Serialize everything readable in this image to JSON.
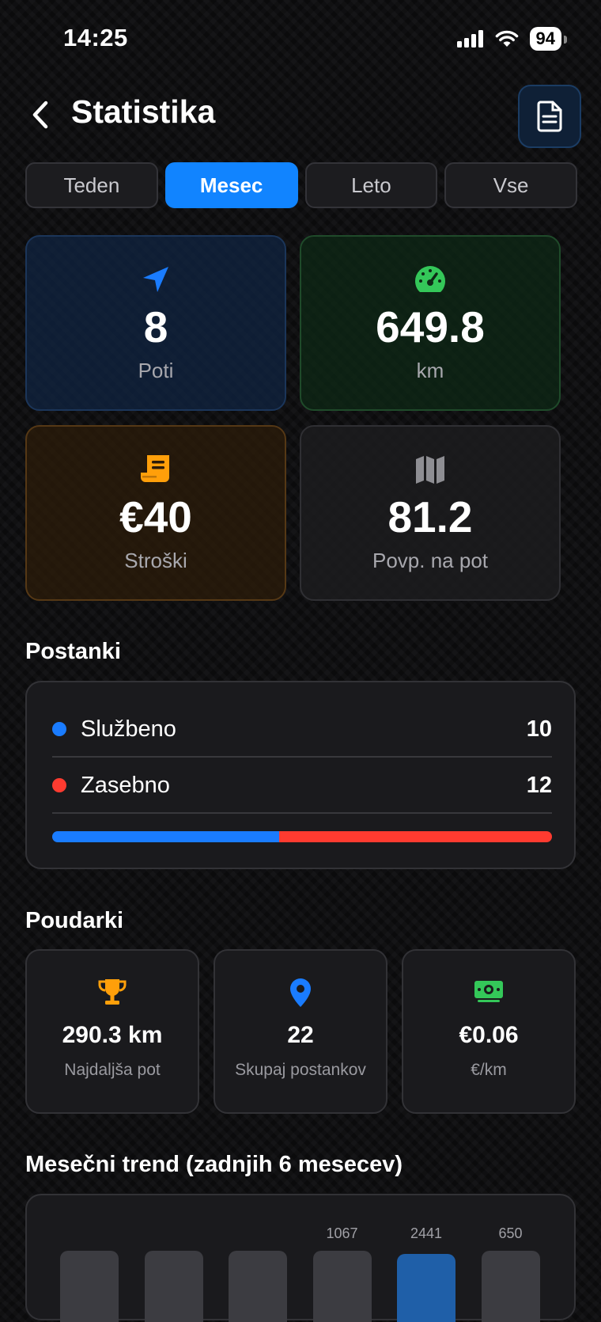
{
  "status": {
    "time": "14:25",
    "battery": "94"
  },
  "header": {
    "title": "Statistika"
  },
  "tabs": [
    {
      "label": "Teden",
      "active": false
    },
    {
      "label": "Mesec",
      "active": true
    },
    {
      "label": "Leto",
      "active": false
    },
    {
      "label": "Vse",
      "active": false
    }
  ],
  "stats": {
    "trips": {
      "value": "8",
      "label": "Poti",
      "icon": "navigation-arrow-icon",
      "color": "#1a7cff"
    },
    "distance": {
      "value": "649.8",
      "label": "km",
      "icon": "speedometer-icon",
      "color": "#34c759"
    },
    "costs": {
      "value": "€40",
      "label": "Stroški",
      "icon": "receipt-icon",
      "color": "#ff9f0a"
    },
    "average": {
      "value": "81.2",
      "label": "Povp. na pot",
      "icon": "map-icon",
      "color": "#8e8e93"
    }
  },
  "stops": {
    "title": "Postanki",
    "business": {
      "label": "Službeno",
      "count": "10",
      "color": "#1a7cff"
    },
    "private": {
      "label": "Zasebno",
      "count": "12",
      "color": "#ff3b30"
    },
    "business_share": 0.4545
  },
  "highlights": {
    "title": "Poudarki",
    "items": [
      {
        "value": "290.3 km",
        "label": "Najdaljša pot",
        "icon": "trophy-icon",
        "color": "#ff9f0a"
      },
      {
        "value": "22",
        "label": "Skupaj postankov",
        "icon": "location-pin-icon",
        "color": "#1a7cff"
      },
      {
        "value": "€0.06",
        "label": "€/km",
        "icon": "money-icon",
        "color": "#34c759"
      }
    ]
  },
  "trend": {
    "title": "Mesečni trend (zadnjih 6 mesecev)"
  },
  "chart_data": {
    "type": "bar",
    "values": [
      null,
      null,
      null,
      1067,
      2441,
      650
    ],
    "value_labels": [
      "",
      "",
      "",
      "1067",
      "2441",
      "650"
    ],
    "highlight_index": 4
  }
}
